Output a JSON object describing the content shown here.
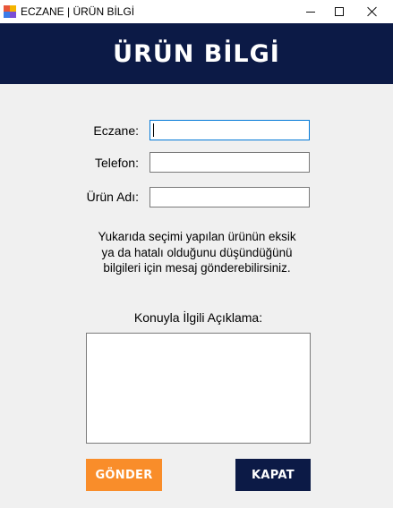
{
  "window": {
    "title": "ECZANE | ÜRÜN BİLGİ",
    "icon": "app-icon",
    "controls": [
      "minimize-icon",
      "maximize-icon",
      "close-icon"
    ]
  },
  "header": {
    "title": "ÜRÜN BİLGİ",
    "background": "#0c1a46"
  },
  "form": {
    "eczane_label": "Eczane:",
    "eczane_value": "",
    "telefon_label": "Telefon:",
    "telefon_value": "",
    "urun_adi_label": "Ürün Adı:",
    "urun_adi_value": ""
  },
  "info_lines": [
    "Yukarıda seçimi yapılan ürünün eksik",
    "ya da hatalı olduğunu düşündüğünü",
    "bilgileri için mesaj gönderebilirsiniz."
  ],
  "aciklama": {
    "label": "Konuyla İlgili Açıklama:",
    "value": ""
  },
  "buttons": {
    "gonder": "GÖNDER",
    "kapat": "KAPAT"
  },
  "colors": {
    "accent_orange": "#f98d2a",
    "navy": "#0c1a46",
    "background": "#f0f0f0"
  }
}
